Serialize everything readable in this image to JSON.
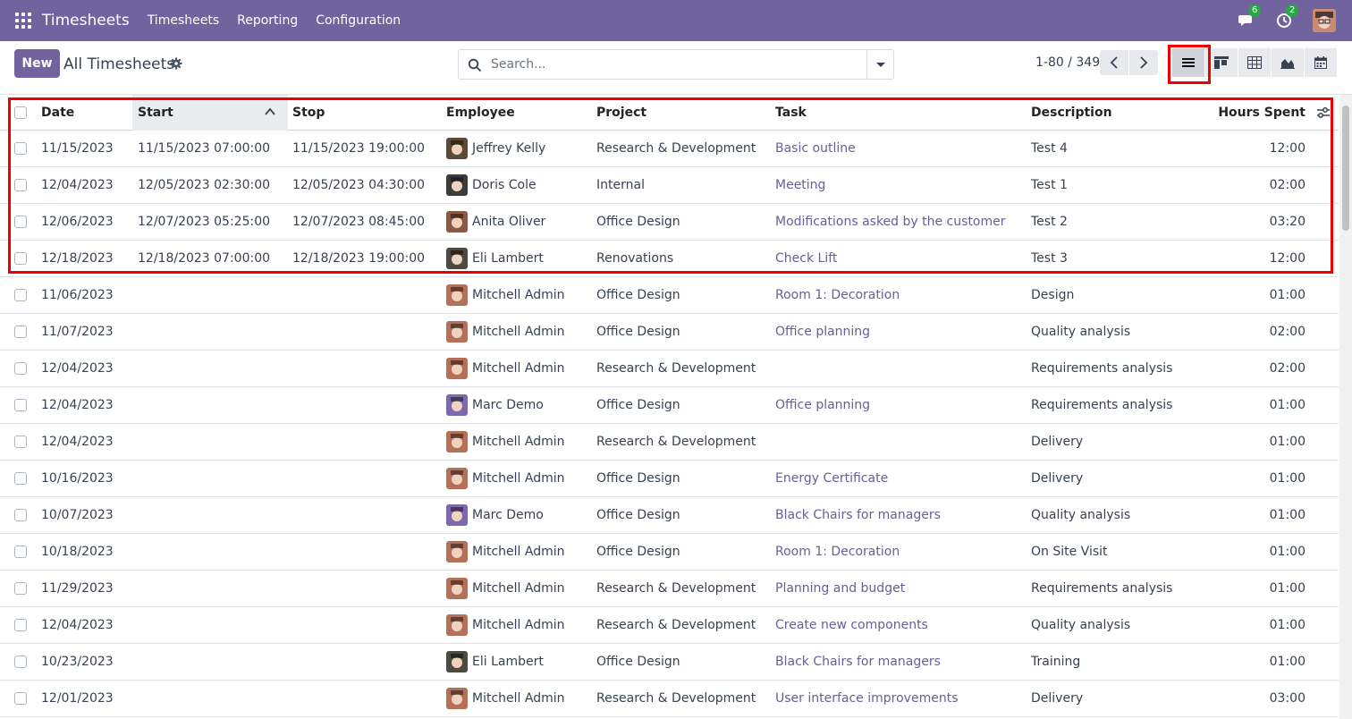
{
  "navbar": {
    "app_title": "Timesheets",
    "menu": [
      "Timesheets",
      "Reporting",
      "Configuration"
    ],
    "messages_count": "6",
    "activities_count": "2",
    "icons": {
      "apps": "apps-grid-icon",
      "messages": "chat-icon",
      "activities": "clock-icon"
    }
  },
  "control": {
    "new_label": "New",
    "breadcrumb": "All Timesheets",
    "search_placeholder": "Search...",
    "pager_value": "1-80 / 349",
    "views": [
      "list",
      "kanban",
      "pivot",
      "graph",
      "calendar"
    ],
    "active_view": "list"
  },
  "table": {
    "headers": {
      "date": "Date",
      "start": "Start",
      "stop": "Stop",
      "employee": "Employee",
      "project": "Project",
      "task": "Task",
      "description": "Description",
      "hours": "Hours Spent"
    },
    "sorted_column": "start",
    "sort_direction": "ascending",
    "rows": [
      {
        "date": "11/15/2023",
        "start": "11/15/2023 07:00:00",
        "stop": "11/15/2023 19:00:00",
        "employee": "Jeffrey Kelly",
        "project": "Research & Development",
        "task": "Basic outline",
        "description": "Test 4",
        "hours": "12:00",
        "avatar_color": "#5b4a3a"
      },
      {
        "date": "12/04/2023",
        "start": "12/05/2023 02:30:00",
        "stop": "12/05/2023 04:30:00",
        "employee": "Doris Cole",
        "project": "Internal",
        "task": "Meeting",
        "description": "Test 1",
        "hours": "02:00",
        "avatar_color": "#3c3c3c"
      },
      {
        "date": "12/06/2023",
        "start": "12/07/2023 05:25:00",
        "stop": "12/07/2023 08:45:00",
        "employee": "Anita Oliver",
        "project": "Office Design",
        "task": "Modifications asked by the customer",
        "description": "Test 2",
        "hours": "03:20",
        "avatar_color": "#8a5a44"
      },
      {
        "date": "12/18/2023",
        "start": "12/18/2023 07:00:00",
        "stop": "12/18/2023 19:00:00",
        "employee": "Eli Lambert",
        "project": "Renovations",
        "task": "Check Lift",
        "description": "Test 3",
        "hours": "12:00",
        "avatar_color": "#4d4a3f"
      },
      {
        "date": "11/06/2023",
        "start": "",
        "stop": "",
        "employee": "Mitchell Admin",
        "project": "Office Design",
        "task": "Room 1: Decoration",
        "description": "Design",
        "hours": "01:00",
        "avatar_color": "#b5705a"
      },
      {
        "date": "11/07/2023",
        "start": "",
        "stop": "",
        "employee": "Mitchell Admin",
        "project": "Office Design",
        "task": "Office planning",
        "description": "Quality analysis",
        "hours": "02:00",
        "avatar_color": "#b5705a"
      },
      {
        "date": "12/04/2023",
        "start": "",
        "stop": "",
        "employee": "Mitchell Admin",
        "project": "Research & Development",
        "task": "",
        "description": "Requirements analysis",
        "hours": "02:00",
        "avatar_color": "#b5705a"
      },
      {
        "date": "12/04/2023",
        "start": "",
        "stop": "",
        "employee": "Marc Demo",
        "project": "Office Design",
        "task": "Office planning",
        "description": "Requirements analysis",
        "hours": "01:00",
        "avatar_color": "#7b68b0"
      },
      {
        "date": "12/04/2023",
        "start": "",
        "stop": "",
        "employee": "Mitchell Admin",
        "project": "Research & Development",
        "task": "",
        "description": "Delivery",
        "hours": "01:00",
        "avatar_color": "#b5705a"
      },
      {
        "date": "10/16/2023",
        "start": "",
        "stop": "",
        "employee": "Mitchell Admin",
        "project": "Office Design",
        "task": "Energy Certificate",
        "description": "Delivery",
        "hours": "01:00",
        "avatar_color": "#b5705a"
      },
      {
        "date": "10/07/2023",
        "start": "",
        "stop": "",
        "employee": "Marc Demo",
        "project": "Office Design",
        "task": "Black Chairs for managers",
        "description": "Quality analysis",
        "hours": "01:00",
        "avatar_color": "#7b68b0"
      },
      {
        "date": "10/18/2023",
        "start": "",
        "stop": "",
        "employee": "Mitchell Admin",
        "project": "Office Design",
        "task": "Room 1: Decoration",
        "description": "On Site Visit",
        "hours": "01:00",
        "avatar_color": "#b5705a"
      },
      {
        "date": "11/29/2023",
        "start": "",
        "stop": "",
        "employee": "Mitchell Admin",
        "project": "Research & Development",
        "task": "Planning and budget",
        "description": "Requirements analysis",
        "hours": "01:00",
        "avatar_color": "#b5705a"
      },
      {
        "date": "12/04/2023",
        "start": "",
        "stop": "",
        "employee": "Mitchell Admin",
        "project": "Research & Development",
        "task": "Create new components",
        "description": "Quality analysis",
        "hours": "01:00",
        "avatar_color": "#b5705a"
      },
      {
        "date": "10/23/2023",
        "start": "",
        "stop": "",
        "employee": "Eli Lambert",
        "project": "Office Design",
        "task": "Black Chairs for managers",
        "description": "Training",
        "hours": "01:00",
        "avatar_color": "#4d4a3f"
      },
      {
        "date": "12/01/2023",
        "start": "",
        "stop": "",
        "employee": "Mitchell Admin",
        "project": "Research & Development",
        "task": "User interface improvements",
        "description": "Delivery",
        "hours": "03:00",
        "avatar_color": "#b5705a"
      }
    ]
  },
  "colors": {
    "brand": "#71639e",
    "link": "#6a5d98",
    "highlight": "#ee0000",
    "badge": "#28a745"
  }
}
